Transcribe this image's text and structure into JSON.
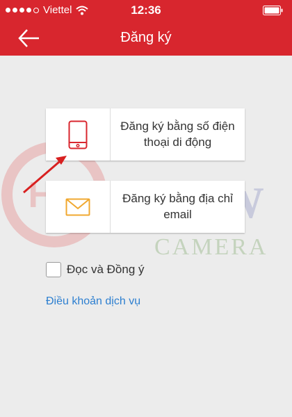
{
  "status_bar": {
    "carrier": "Viettel",
    "time": "12:36"
  },
  "nav": {
    "title": "Đăng ký"
  },
  "options": {
    "phone_label": "Đăng ký bằng số điện thoại di động",
    "email_label": "Đăng ký bằng địa chỉ email"
  },
  "agreement": {
    "checkbox_label": "Đọc và Đồng ý",
    "checked": false,
    "terms_link": "Điều khoản dịch vụ"
  },
  "watermark": {
    "logo_text": "HD",
    "text_new": "NEW",
    "text_camera": "CAMERA"
  },
  "colors": {
    "brand_red": "#d8262e",
    "link_blue": "#2d7fd0",
    "email_icon_orange": "#f0a830",
    "background": "#ececec"
  }
}
